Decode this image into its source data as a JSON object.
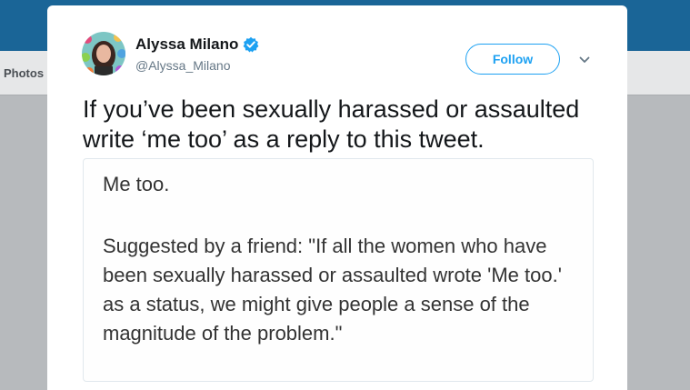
{
  "background": {
    "subnav_label": "Photos",
    "topbar_color": "#1a6597"
  },
  "tweet": {
    "author_name": "Alyssa Milano",
    "author_handle": "@Alyssa_Milano",
    "verified": true,
    "follow_label": "Follow",
    "text": "If you’ve been sexually harassed or assaulted write ‘me too’ as a reply to this tweet.",
    "media": {
      "line1": "Me too.",
      "paragraph": "Suggested by a friend: \"If all the women who have been sexually harassed or assaulted wrote 'Me too.' as a status, we might give people a sense of the magnitude of the problem.\""
    }
  },
  "colors": {
    "accent": "#1da1f2",
    "text": "#14171a",
    "muted": "#657786"
  },
  "icons": [
    "verified-badge-icon",
    "chevron-down-icon"
  ]
}
